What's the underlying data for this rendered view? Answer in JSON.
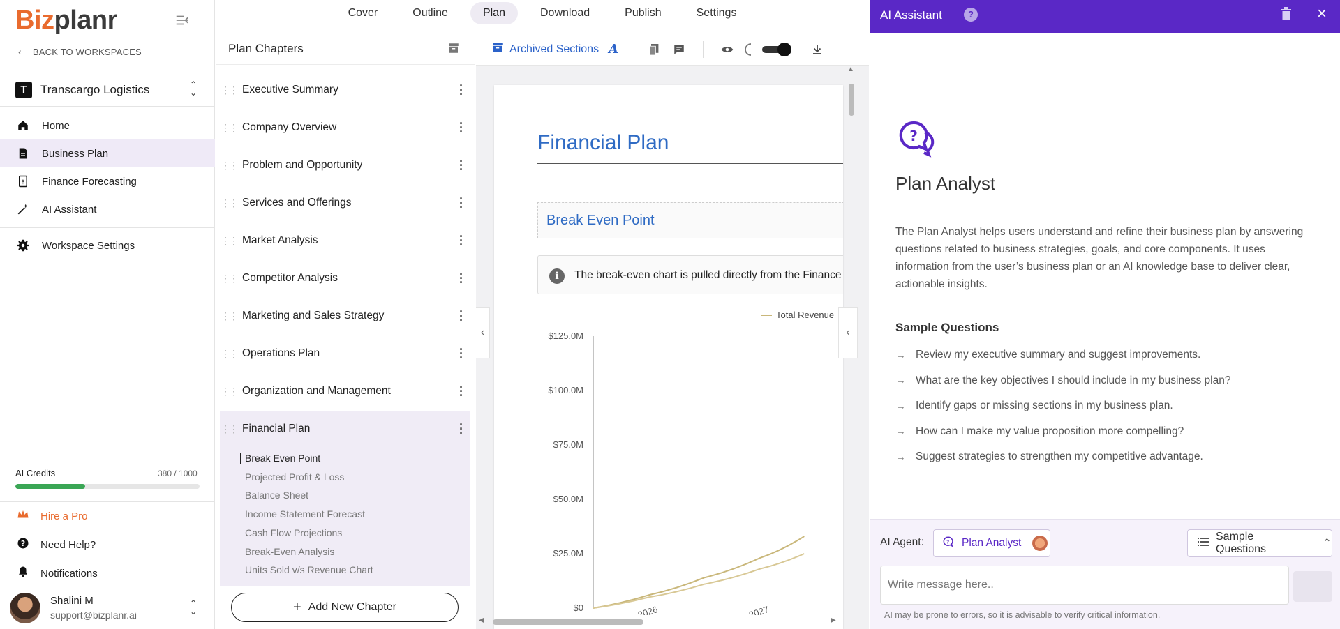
{
  "brand": {
    "part1": "Biz",
    "part2": "planr"
  },
  "sidebar": {
    "back_label": "BACK TO WORKSPACES",
    "workspace": {
      "initial": "T",
      "name": "Transcargo Logistics"
    },
    "nav": [
      {
        "label": "Home",
        "icon": "home-icon"
      },
      {
        "label": "Business Plan",
        "icon": "document-icon"
      },
      {
        "label": "Finance Forecasting",
        "icon": "finance-icon"
      },
      {
        "label": "AI Assistant",
        "icon": "magic-wand-icon"
      }
    ],
    "settings_label": "Workspace Settings",
    "credits": {
      "label": "AI Credits",
      "count": "380 / 1000",
      "used": 380,
      "total": 1000
    },
    "hire_pro": "Hire a Pro",
    "help": "Need Help?",
    "notifications": "Notifications",
    "user": {
      "name": "Shalini M",
      "email": "support@bizplanr.ai"
    }
  },
  "topnav": {
    "tabs": [
      "Cover",
      "Outline",
      "Plan",
      "Download",
      "Publish",
      "Settings"
    ],
    "active": "Plan"
  },
  "chapters": {
    "title": "Plan Chapters",
    "items": [
      "Executive Summary",
      "Company Overview",
      "Problem and Opportunity",
      "Services and Offerings",
      "Market Analysis",
      "Competitor Analysis",
      "Marketing and Sales Strategy",
      "Operations Plan",
      "Organization and Management",
      "Financial Plan"
    ],
    "sub_items": [
      "Break Even Point",
      "Projected Profit & Loss",
      "Balance Sheet",
      "Income Statement Forecast",
      "Cash Flow Projections",
      "Break-Even Analysis",
      "Units Sold v/s Revenue Chart"
    ],
    "add_label": "Add New Chapter"
  },
  "toolbar": {
    "archived_label": "Archived Sections"
  },
  "document": {
    "title": "Financial Plan",
    "section_title": "Break Even Point",
    "info_text": "The break-even chart is pulled directly from the Finance"
  },
  "chart_data": {
    "type": "line",
    "legend": [
      "Total Revenue"
    ],
    "y_ticks": [
      "$0",
      "$25.0M",
      "$50.0M",
      "$75.0M",
      "$100.0M",
      "$125.0M"
    ],
    "x_ticks": [
      "2026",
      "2027"
    ],
    "ylim": [
      0,
      125
    ],
    "x": [
      2025.5,
      2026,
      2026.5,
      2027,
      2027.4
    ],
    "series": [
      {
        "name": "Total Revenue",
        "values": [
          0,
          6,
          14,
          23,
          33
        ]
      },
      {
        "values": [
          0,
          5,
          11,
          18,
          25
        ]
      }
    ],
    "colors": [
      "#c9b77a",
      "#d8c895"
    ]
  },
  "ai_panel": {
    "title": "AI Assistant",
    "agent_title": "Plan Analyst",
    "description": "The Plan Analyst helps users understand and refine their business plan by answering questions related to business strategies, goals, and core components. It uses information from the user’s business plan or an AI knowledge base to deliver clear, actionable insights.",
    "sample_title": "Sample Questions",
    "questions": [
      "Review my executive summary and suggest improvements.",
      "What are the key objectives I should include in my business plan?",
      "Identify gaps or missing sections in my business plan.",
      "How can I make my value proposition more compelling?",
      "Suggest strategies to strengthen my competitive advantage."
    ],
    "agent_label": "AI Agent:",
    "agent_name": "Plan Analyst",
    "sample_button": "Sample Questions",
    "input_placeholder": "Write message here..",
    "disclaimer": "AI may be prone to errors, so it is advisable to verify critical information.",
    "accent": "#5a28c6"
  }
}
